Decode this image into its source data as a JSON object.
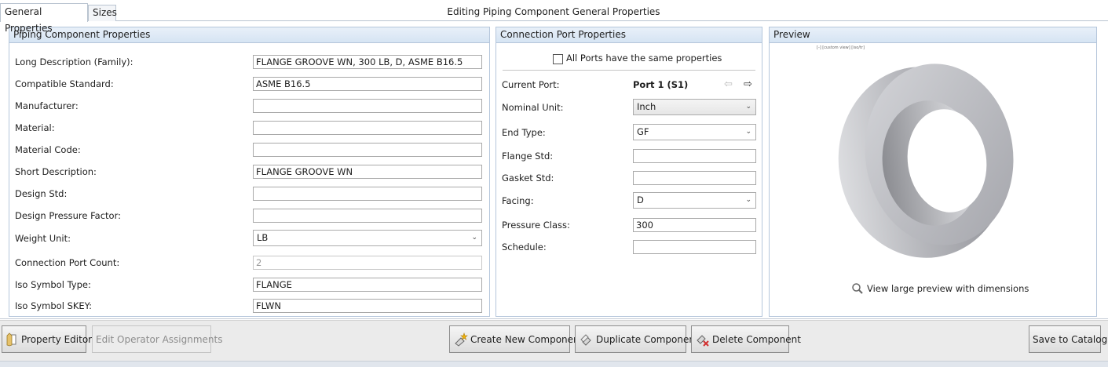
{
  "tabs": [
    {
      "label": "General Properties",
      "active": true
    },
    {
      "label": "Sizes",
      "active": false
    }
  ],
  "window_title": "Editing Piping Component General Properties",
  "piping_panel": {
    "title": "Piping Component Properties",
    "rows": [
      {
        "label": "Long Description (Family):",
        "value": "FLANGE GROOVE WN, 300 LB, D, ASME B16.5",
        "kind": "text"
      },
      {
        "label": "Compatible Standard:",
        "value": "ASME B16.5",
        "kind": "text"
      },
      {
        "label": "Manufacturer:",
        "value": "",
        "kind": "text"
      },
      {
        "label": "Material:",
        "value": "",
        "kind": "text"
      },
      {
        "label": "Material Code:",
        "value": "",
        "kind": "text"
      },
      {
        "label": "Short Description:",
        "value": "FLANGE GROOVE WN",
        "kind": "text"
      },
      {
        "label": "Design Std:",
        "value": "",
        "kind": "text"
      },
      {
        "label": "Design Pressure Factor:",
        "value": "",
        "kind": "text"
      },
      {
        "label": "Weight Unit:",
        "value": "LB",
        "kind": "select"
      },
      {
        "label": "Connection Port Count:",
        "value": "2",
        "kind": "disabled"
      },
      {
        "label": "Iso Symbol Type:",
        "value": "FLANGE",
        "kind": "text"
      },
      {
        "label": "Iso Symbol SKEY:",
        "value": "FLWN",
        "kind": "text"
      }
    ]
  },
  "port_panel": {
    "title": "Connection Port Properties",
    "same_props_label": "All Ports have the same properties",
    "same_props_checked": false,
    "current_port_label": "Current Port:",
    "current_port_value": "Port 1 (S1)",
    "rows": [
      {
        "label": "Nominal Unit:",
        "value": "Inch",
        "kind": "select-gray"
      },
      {
        "label": "End Type:",
        "value": "GF",
        "kind": "select"
      },
      {
        "label": "Flange Std:",
        "value": "",
        "kind": "text"
      },
      {
        "label": "Gasket Std:",
        "value": "",
        "kind": "text"
      },
      {
        "label": "Facing:",
        "value": "D",
        "kind": "select"
      },
      {
        "label": "Pressure Class:",
        "value": "300",
        "kind": "text"
      },
      {
        "label": "Schedule:",
        "value": "",
        "kind": "text"
      }
    ]
  },
  "preview_panel": {
    "title": "Preview",
    "small_caption": "[-] [custom view] [iso/tr]",
    "link_label": "View large preview with dimensions"
  },
  "bottom_buttons": {
    "property_editor": "Property Editor",
    "edit_operator": "Edit Operator Assignments",
    "create_new": "Create New Component",
    "duplicate": "Duplicate Component",
    "delete": "Delete Component",
    "save_catalog": "Save to Catalog"
  },
  "icons": {
    "prev_port": "arrow-left-icon",
    "next_port": "arrow-right-icon",
    "magnifier": "magnifier-icon",
    "property_editor": "pencil-document-icon",
    "create_new": "new-component-icon",
    "duplicate": "duplicate-component-icon",
    "delete": "delete-component-icon"
  },
  "colors": {
    "panel_header": "#d6e4f3",
    "panel_border": "#b5c6db",
    "flange": "#c8c8cc",
    "delete_accent": "#d23030",
    "new_accent": "#e8a000"
  }
}
